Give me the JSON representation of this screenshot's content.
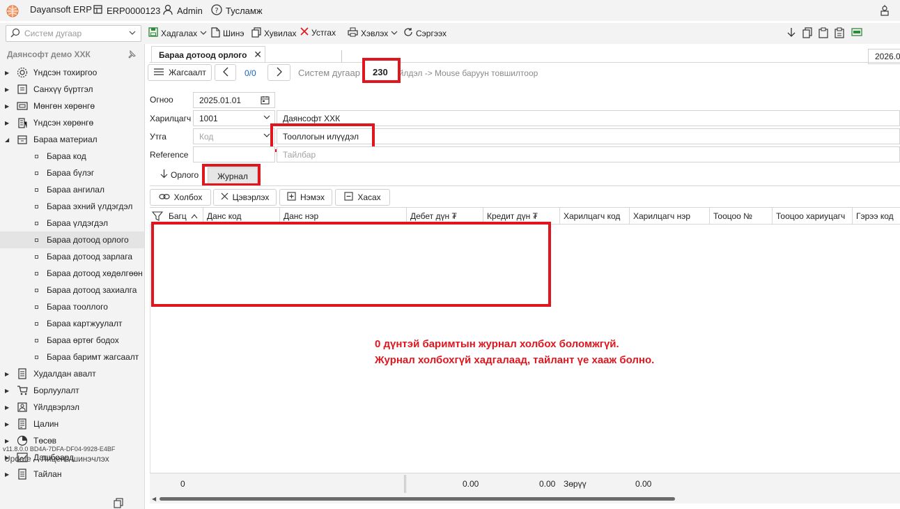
{
  "titlebar": {
    "app_name": "Dayansoft ERP",
    "db_name": "ERP0000123",
    "user": "Admin",
    "help": "Тусламж"
  },
  "toolbar": {
    "search_placeholder": "Систем дугаар",
    "save": "Хадгалах",
    "new": "Шинэ",
    "copy": "Хувилах",
    "delete": "Устгах",
    "print": "Хэвлэх",
    "refresh": "Сэргээх",
    "date": "2026.0"
  },
  "sidebar": {
    "company": "Даянсофт демо ХХК",
    "items": [
      {
        "label": "Үндсэн тохиргоо",
        "icon": "gear-icon"
      },
      {
        "label": "Санхүү бүртгэл",
        "icon": "ledger-icon"
      },
      {
        "label": "Мөнгөн хөрөнгө",
        "icon": "money-icon"
      },
      {
        "label": "Үндсэн хөрөнгө",
        "icon": "building-icon"
      },
      {
        "label": "Бараа материал",
        "icon": "inventory-icon"
      }
    ],
    "sub_items": [
      "Бараа код",
      "Бараа бүлэг",
      "Бараа ангилал",
      "Бараа эхний үлдэгдэл",
      "Бараа үлдэгдэл",
      "Бараа дотоод орлого",
      "Бараа дотоод зарлага",
      "Бараа дотоод хөдөлгөөн",
      "Бараа дотоод захиалга",
      "Бараа тооллого",
      "Бараа картжуулалт",
      "Бараа өртөг бодох",
      "Бараа баримт жагсаалт"
    ],
    "items_after": [
      {
        "label": "Худалдан авалт",
        "icon": "purchase-icon"
      },
      {
        "label": "Борлуулалт",
        "icon": "cart-icon"
      },
      {
        "label": "Үйлдвэрлэл",
        "icon": "production-icon"
      },
      {
        "label": "Цалин",
        "icon": "payroll-icon"
      },
      {
        "label": "Төсөв",
        "icon": "budget-icon"
      },
      {
        "label": "Дашбоард",
        "icon": "dashboard-icon"
      },
      {
        "label": "Тайлан",
        "icon": "report-icon"
      }
    ],
    "version": "v11.8.0.0   BD4A-7DFA-DF04-9928-E4BF",
    "update": "Update",
    "license": "Лиценз шинэчлэх"
  },
  "document": {
    "tab_title": "Бараа дотоод орлого",
    "list_button": "Жагсаалт",
    "counter": "0/0",
    "sysnum_label": "Систем дугаар /",
    "sysnum_value": "230",
    "hint": "Үйлдэл -> Mouse баруун товшилтоор"
  },
  "form": {
    "date_label": "Огноо",
    "date_value": "2025.01.01",
    "customer_label": "Харилцагч",
    "customer_code": "1001",
    "customer_name": "Даянсофт ХХК",
    "purpose_label": "Утга",
    "purpose_code_placeholder": "Код",
    "purpose_value": "Тооллогын илүүдэл",
    "reference_label": "Reference",
    "note_placeholder": "Тайлбар"
  },
  "subtabs": {
    "income": "Орлого",
    "journal": "Журнал"
  },
  "grid_actions": {
    "link": "Холбох",
    "unlink": "Цэвэрлэх",
    "add": "Нэмэх",
    "remove": "Хасах"
  },
  "grid": {
    "columns": [
      "Багц",
      "Данс код",
      "Данс нэр",
      "Дебет дүн ₮",
      "Кредит дүн ₮",
      "Харилцагч код",
      "Харилцагч нэр",
      "Тооцоо №",
      "Тооцоо хариуцагч",
      "Гэрээ код"
    ],
    "footer": {
      "count": "0",
      "debit_total": "0.00",
      "credit_total": "0.00",
      "diff_label": "Зөрүү",
      "diff_value": "0.00"
    }
  },
  "annotation": {
    "line1": "0 дүнтэй баримтын журнал холбох боломжгүй.",
    "line2": "Журнал холбохгүй хадгалаад, тайлант үе хааж болно."
  },
  "colors": {
    "highlight": "#e0161e",
    "link_blue": "#1565c0"
  }
}
